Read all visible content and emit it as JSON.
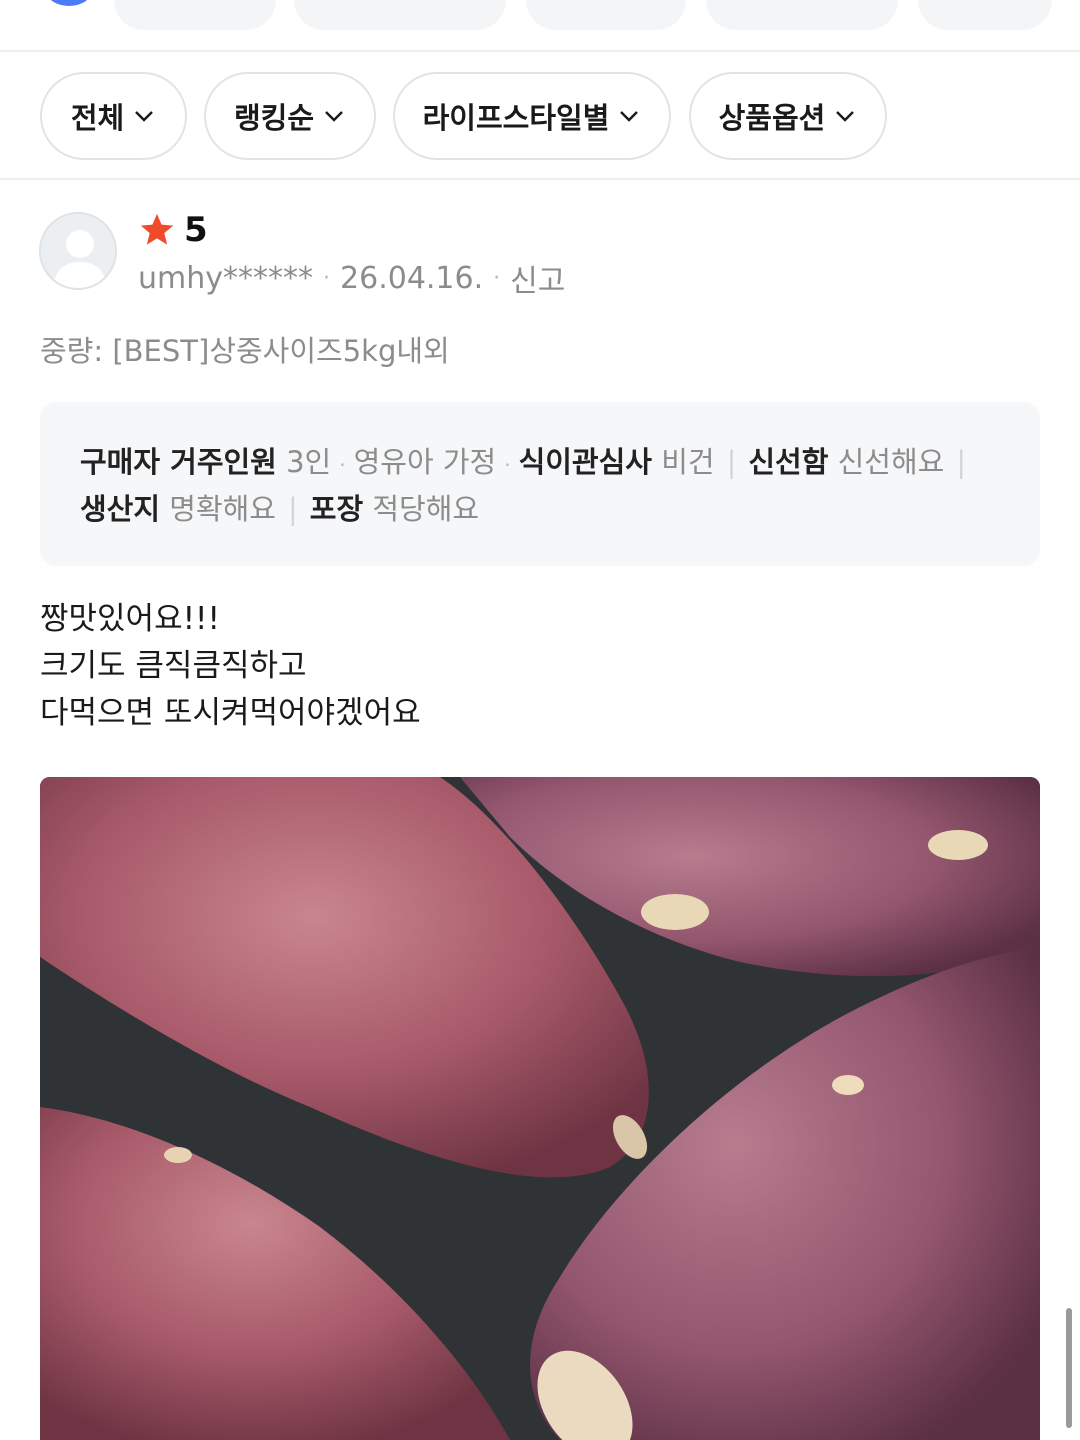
{
  "filters": [
    {
      "label": "전체"
    },
    {
      "label": "랭킹순"
    },
    {
      "label": "라이프스타일별"
    },
    {
      "label": "상품옵션"
    }
  ],
  "review": {
    "rating": "5",
    "user": "umhy******",
    "date": "26.04.16.",
    "report_label": "신고",
    "option": "중량: [BEST]상중사이즈5kg내외",
    "survey": {
      "household_key": "구매자 거주인원",
      "household_value": "3인",
      "infant_value": "영유아 가정",
      "picky_key": "식이관심사",
      "picky_value": "비건",
      "fresh_key": "신선함",
      "fresh_value": "신선해요",
      "origin_key": "생산지",
      "origin_value": "명확해요",
      "pack_key": "포장",
      "pack_value": "적당해요"
    },
    "text_lines": [
      "짱맛있어요!!!",
      "크기도 큼직큼직하고",
      "다먹으면 또시켜먹어야겠어요"
    ]
  },
  "colors": {
    "star": "#f04b2a",
    "muted_text": "#8c8c8c",
    "chip_border": "#e3e3e3",
    "survey_bg": "#f6f7f9"
  },
  "icons": {
    "chevron": "chevron-down-icon",
    "star": "star-icon",
    "avatar": "avatar-placeholder-icon"
  }
}
